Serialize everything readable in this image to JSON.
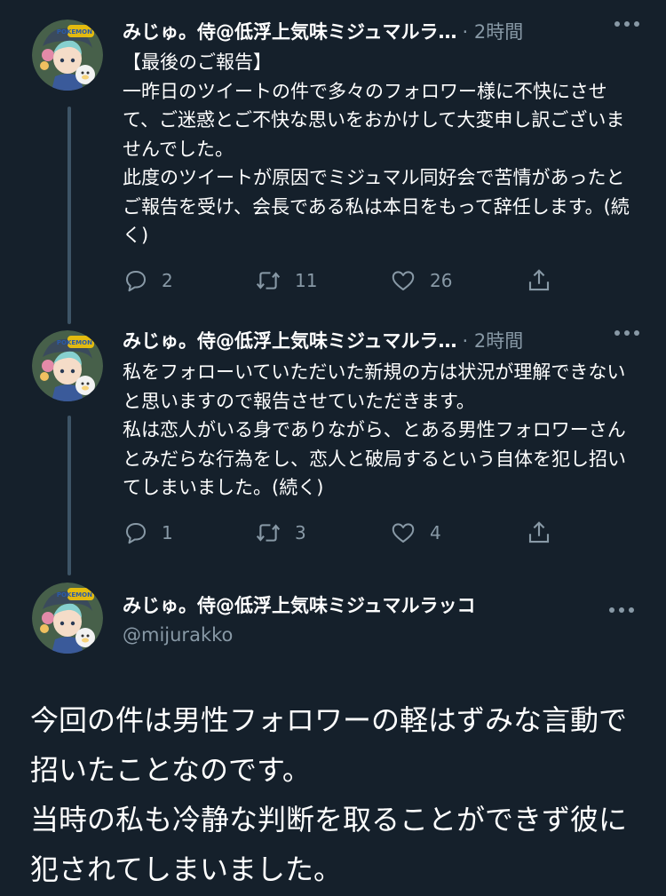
{
  "tweets": [
    {
      "author_name": "みじゅ。侍@低浮上気味ミジュマルラ…",
      "time": "· 2時間",
      "text": "【最後のご報告】\n一昨日のツイートの件で多々のフォロワー様に不快にさせて、ご迷惑とご不快な思いをおかけして大変申し訳ございませんでした。\n此度のツイートが原因でミジュマル同好会で苦情があったとご報告を受け、会長である私は本日をもって辞任します。(続く)",
      "replies": "2",
      "retweets": "11",
      "likes": "26"
    },
    {
      "author_name": "みじゅ。侍@低浮上気味ミジュマルラ…",
      "time": "· 2時間",
      "text": "私をフォローいていただいた新規の方は状況が理解できないと思いますので報告させていただきます。\n私は恋人がいる身でありながら、とある男性フォロワーさんとみだらな行為をし、恋人と破局するという自体を犯し招いてしまいました。(続く)",
      "replies": "1",
      "retweets": "3",
      "likes": "4"
    }
  ],
  "main_tweet": {
    "author_name": "みじゅ。侍@低浮上気味ミジュマルラッコ",
    "handle": "@mijurakko",
    "text": "今回の件は男性フォロワーの軽はずみな言動で招いたことなのです。\n当時の私も冷静な判断を取ることができず彼に犯されてしまいました。"
  },
  "avatar_badge_text": "POKEMON GO",
  "icons": [
    "reply-icon",
    "retweet-icon",
    "like-icon",
    "share-icon",
    "more-icon"
  ],
  "colors": {
    "background": "#15202b",
    "secondary_text": "#8899a6",
    "thread_line": "#3d5466"
  }
}
